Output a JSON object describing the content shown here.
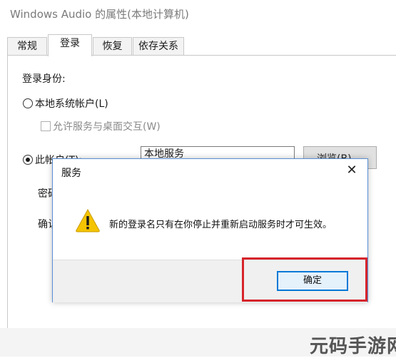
{
  "window": {
    "title": "Windows Audio 的属性(本地计算机)"
  },
  "tabs": [
    {
      "label": "常规"
    },
    {
      "label": "登录",
      "active": true
    },
    {
      "label": "恢复"
    },
    {
      "label": "依存关系"
    }
  ],
  "logon": {
    "section_label": "登录身份:",
    "local_system_label": "本地系统帐户(L)",
    "allow_desktop_label": "允许服务与桌面交互(W)",
    "this_account_label": "此帐户(T):",
    "account_value": "本地服务",
    "browse_label": "浏览(B)...",
    "password_label": "密码",
    "confirm_label": "确认"
  },
  "dialog": {
    "title": "服务",
    "message": "新的登录名只有在你停止并重新启动服务时才可生效。",
    "ok_label": "确定",
    "close_glyph": "✕"
  },
  "watermark": "元码手游网",
  "colors": {
    "accent": "#0078d7",
    "highlight": "#d6242b",
    "warning": "#f5c400"
  }
}
